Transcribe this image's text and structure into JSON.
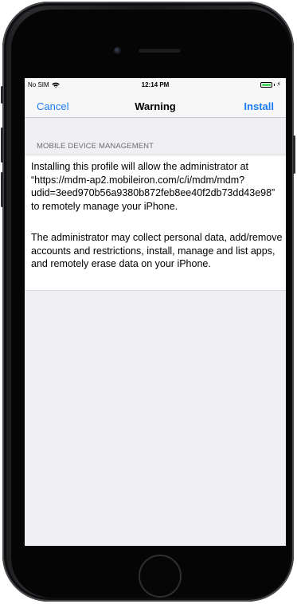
{
  "device": {
    "model": "iPhone",
    "frame_icons": [
      "front-camera-icon",
      "earpiece-speaker-icon",
      "home-button-icon"
    ]
  },
  "status_bar": {
    "carrier": "No SIM",
    "time": "12:14 PM",
    "wifi_icon": "wifi-icon",
    "battery_icon": "battery-icon",
    "charging_icon": "charging-bolt-icon",
    "battery_color": "#4cd964"
  },
  "nav": {
    "left_label": "Cancel",
    "title": "Warning",
    "right_label": "Install",
    "accent_color": "#1a7cf5"
  },
  "section": {
    "header": "MOBILE DEVICE MANAGEMENT",
    "paragraph_1": "Installing this profile will allow the administrator at “https://mdm-ap2.mobileiron.com/c/i/mdm/mdm?udid=3eed970b56a9380b872feb8ee40f2db73dd43e98” to remotely manage your iPhone.",
    "paragraph_2": "The administrator may collect personal data, add/remove accounts and restrictions, install, manage and list apps, and remotely erase data on your iPhone."
  }
}
